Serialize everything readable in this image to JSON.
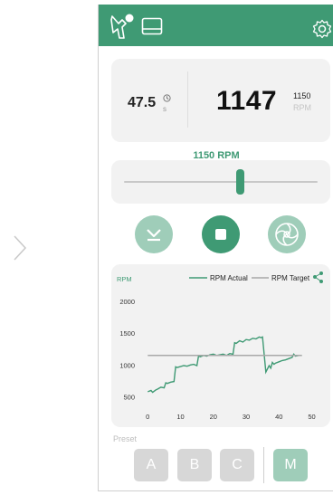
{
  "readout": {
    "torque_value": "47.5",
    "torque_unit": "s",
    "rpm_actual": "1147",
    "rpm_target": "1150",
    "rpm_unit": "RPM"
  },
  "slider": {
    "label": "1150 RPM",
    "level_fraction": 0.6
  },
  "icons": {
    "topbar_left": "drill-icon",
    "topbar_center": "console-icon",
    "topbar_right": "gear-icon",
    "controls": [
      "chevron-down-icon",
      "stop-icon",
      "spin-icon"
    ]
  },
  "colors": {
    "accent": "#3f9a74",
    "accent_light": "#9fcdb9",
    "target_line": "#a8a8a8"
  },
  "chart_data": {
    "type": "line",
    "ylabel": "RPM",
    "x_ticks": [
      "0",
      "10",
      "20",
      "30",
      "40",
      "50"
    ],
    "y_ticks": [
      "2000",
      "1500",
      "1000",
      "500"
    ],
    "xlim": [
      -2,
      54
    ],
    "ylim": [
      450,
      2100
    ],
    "legend_position": "top",
    "series": [
      {
        "name": "RPM Actual",
        "color": "#3f9a74",
        "x": [
          0,
          1,
          1.5,
          2.5,
          3,
          4,
          5,
          5.5,
          6,
          7,
          8,
          8.5,
          9,
          10,
          11,
          12,
          13,
          14,
          15,
          15.5,
          16,
          17,
          18,
          19,
          20,
          21,
          22,
          23,
          24,
          25,
          26,
          26.5,
          27,
          28,
          29,
          30,
          31,
          32,
          33,
          34,
          34.5,
          35,
          36,
          37,
          37.5,
          38,
          38.5,
          39,
          40,
          41,
          42,
          43,
          44,
          44.5,
          45,
          46,
          47
        ],
        "y": [
          580,
          600,
          570,
          610,
          620,
          650,
          640,
          720,
          710,
          730,
          740,
          970,
          960,
          975,
          990,
          980,
          1000,
          1010,
          990,
          1140,
          1130,
          1150,
          1140,
          1160,
          1170,
          1150,
          1160,
          1170,
          1150,
          1180,
          1170,
          1350,
          1340,
          1380,
          1360,
          1400,
          1390,
          1420,
          1410,
          1440,
          1430,
          1440,
          890,
          990,
          950,
          1040,
          1010,
          1030,
          1050,
          1070,
          1080,
          1100,
          1120,
          1170,
          1140,
          1150,
          1150
        ]
      },
      {
        "name": "RPM Target",
        "color": "#a8a8a8",
        "x": [
          0,
          47
        ],
        "y": [
          1150,
          1150
        ]
      }
    ]
  },
  "presets": {
    "label": "Preset",
    "buttons": [
      "A",
      "B",
      "C"
    ],
    "manual": "M"
  }
}
